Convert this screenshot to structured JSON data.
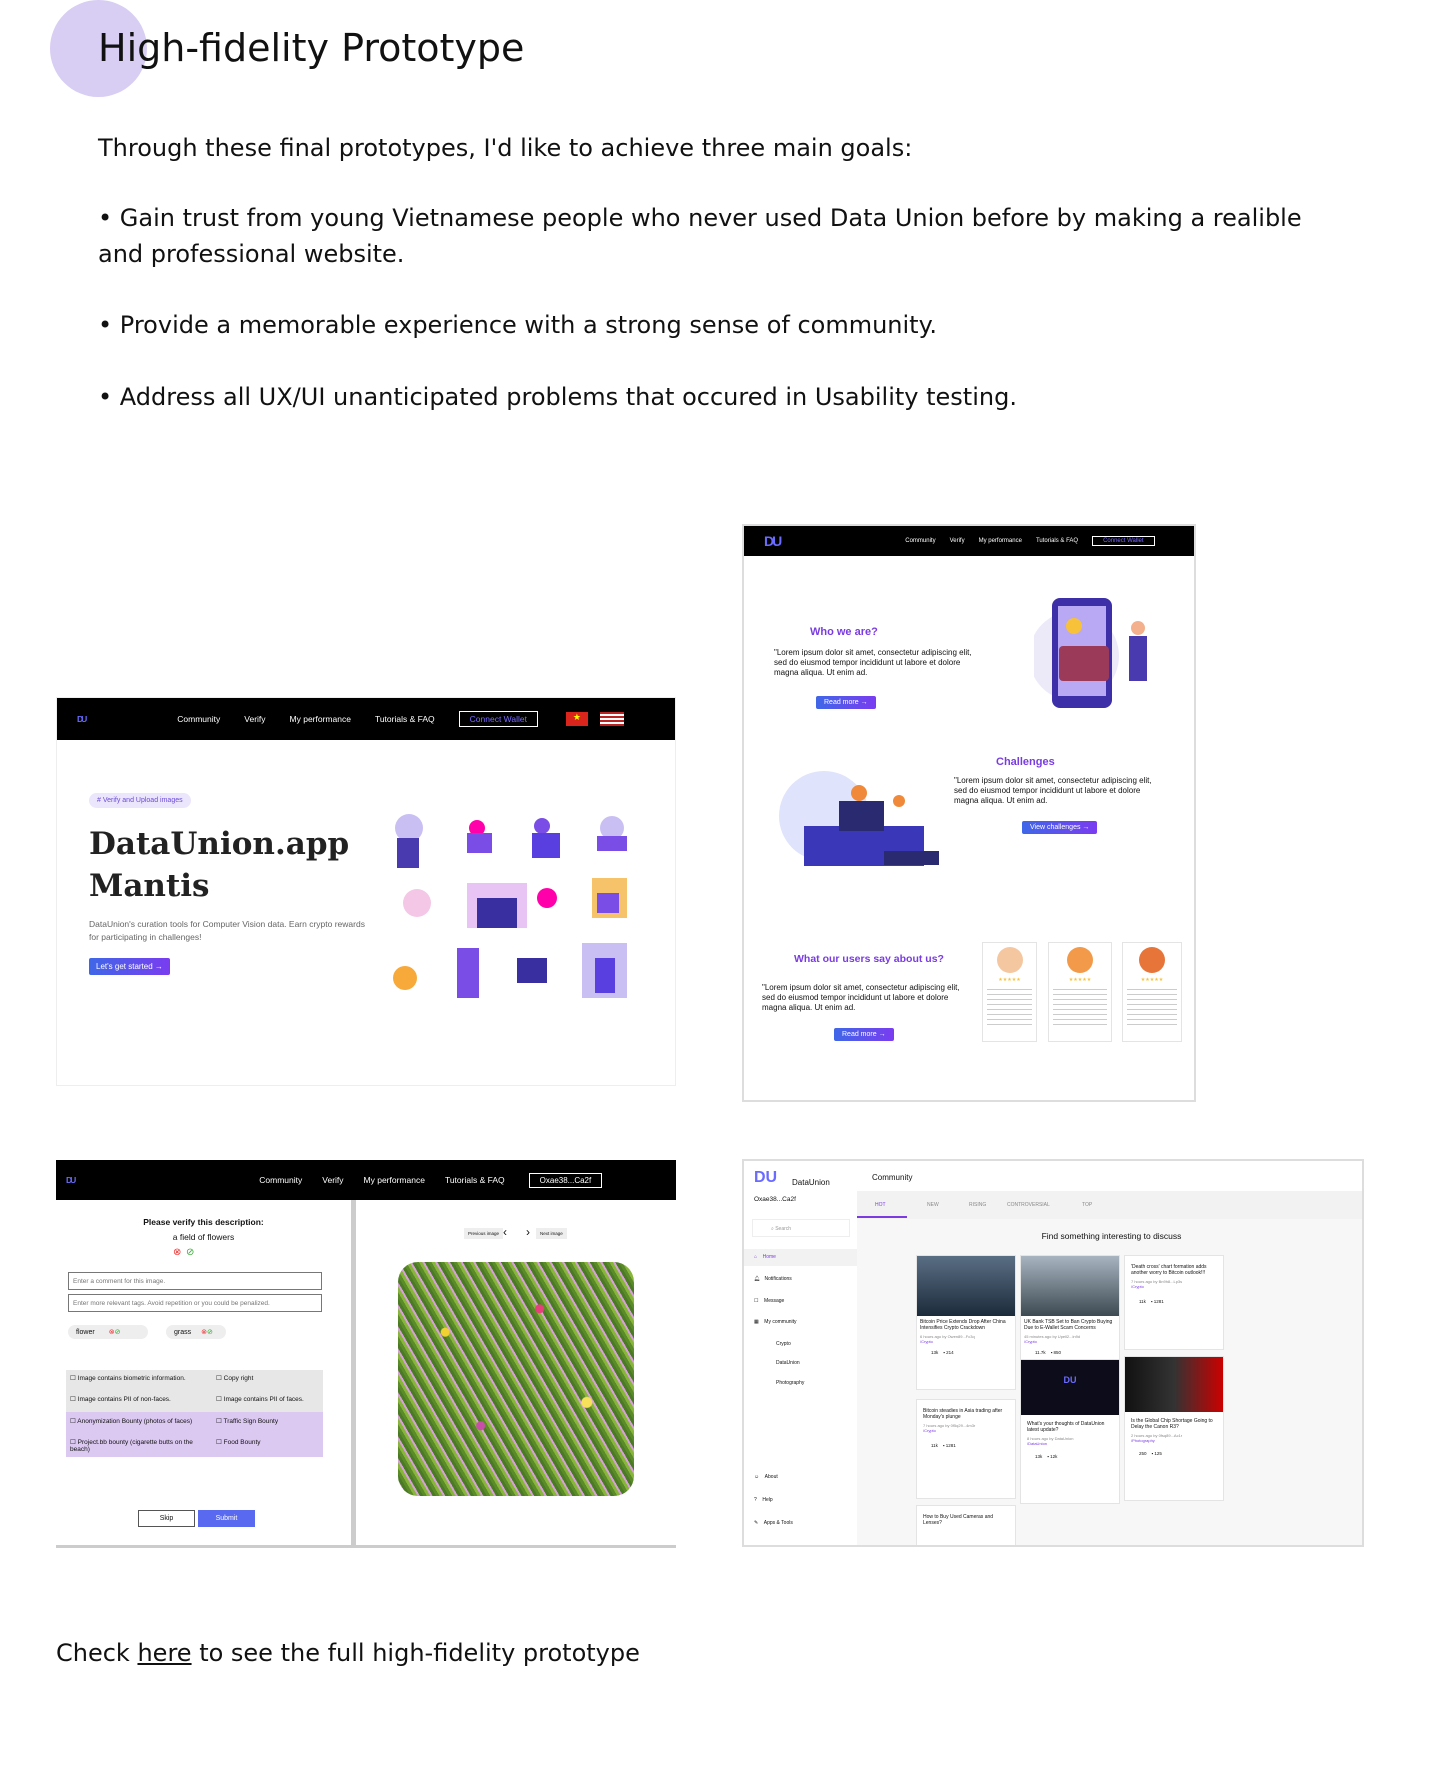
{
  "heading": "High-fidelity  Prototype",
  "intro": {
    "lead": "Through these final prototypes, I'd like to achieve three main goals:",
    "goal1": "• Gain trust from young Vietnamese people who never used Data Union before by making a realible and professional website.",
    "goal2": "• Provide a memorable experience with a strong sense of community.",
    "goal3": "• Address all UX/UI unanticipated problems that occured in Usability testing."
  },
  "landing": {
    "logo": "DU",
    "nav": [
      "Community",
      "Verify",
      "My performance",
      "Tutorials & FAQ"
    ],
    "wallet": "Connect Wallet",
    "tag": "# Verify and Upload images",
    "title1": "DataUnion.app",
    "title2": "Mantis",
    "desc": "DataUnion's curation tools for Computer Vision data. Earn crypto rewards for participating in challenges!",
    "cta": "Let's get started →"
  },
  "about": {
    "logo": "DU",
    "nav": [
      "Community",
      "Verify",
      "My performance",
      "Tutorials & FAQ"
    ],
    "wallet": "Connect Wallet",
    "who": "Who we are?",
    "lorem": "\"Lorem ipsum dolor sit amet, consectetur adipiscing elit, sed do eiusmod tempor incididunt ut labore et dolore magna aliqua. Ut enim ad.",
    "read": "Read more →",
    "challenges": "Challenges",
    "view": "View challenges →",
    "users": "What our users say about us?",
    "stars": "★★★★★"
  },
  "verify": {
    "logo": "DU",
    "nav": [
      "Community",
      "Verify",
      "My performance",
      "Tutorials & FAQ"
    ],
    "wallet": "Oxae38...Ca2f",
    "prompt": "Please verify this description:",
    "desc": "a field of flowers",
    "comment_ph": "Enter a comment for this image.",
    "tags_ph": "Enter more relevant tags. Avoid repetition or you could be penalized.",
    "tag1": "flower",
    "tag2": "grass",
    "checks": [
      "Image contains biometric information.",
      "Copy right",
      "Image contains PII of non-faces.",
      "Image contains PII of faces.",
      "Anonymization Bounty (photos of faces)",
      "Traffic Sign Bounty",
      "Project.bb bounty (cigarette butts on the beach)",
      "Food Bounty"
    ],
    "skip": "Skip",
    "submit": "Submit",
    "prev": "Previous image",
    "next": "Next image"
  },
  "community": {
    "brand": "DataUnion",
    "wallet": "Oxae38...Ca2f",
    "search": "Search",
    "menu": [
      "Home",
      "Notifications",
      "Message",
      "My community"
    ],
    "sub": [
      "Crypto",
      "DataUnion",
      "Photography"
    ],
    "bottom": [
      "About",
      "Help",
      "Apps & Tools"
    ],
    "header": "Community",
    "tabs": [
      "HOT",
      "NEW",
      "RISING",
      "CONTROVERSIAL",
      "TOP"
    ],
    "find": "Find something interesting to discuss",
    "posts": [
      {
        "title": "Bitcoin Price Extends Drop After China Intensifies Crypto Crackdown",
        "meta": "6 hours ago by Owen89...Fc3q",
        "tag": "/Crypto",
        "votes": "13k",
        "comments": "214"
      },
      {
        "title": "UK Bank TSB Set to Ban Crypto Buying Due to E-Wallet Scam Concerns",
        "meta": "45 minutes ago by Upell2...ln9d",
        "tag": "/Crypto",
        "votes": "11.7k",
        "comments": "850"
      },
      {
        "title": "'Death cross' chart formation adds another worry to Bitcoin outlook!!!",
        "meta": "7 hours ago by Bn9h8...Lp3s",
        "tag": "/Crypto",
        "votes": "11k",
        "comments": "1281"
      },
      {
        "title": "Bitcoin steadies in Asia trading after Monday's plunge",
        "meta": "7 hours ago by 0f5q29...4m3r",
        "tag": "/Crypto",
        "votes": "11k",
        "comments": "1281"
      },
      {
        "title": "What's your thoughts of DataUnion latest update?",
        "meta": "8 hours ago by DataUnion",
        "tag": "/DataUnion",
        "votes": "13k",
        "comments": "12k"
      },
      {
        "title": "Is the Global Chip Shortage Going to Delay the Canon R3?",
        "meta": "2 hours ago by 0fsq89...Ac1r",
        "tag": "/Photography",
        "votes": "250",
        "comments": "125"
      },
      {
        "title": "How to Buy Used Cameras and Lenses?",
        "meta": "",
        "tag": "",
        "votes": "",
        "comments": ""
      }
    ]
  },
  "footer": {
    "pre": "Check ",
    "link": "here",
    "post": " to see the full high-fidelity prototype"
  }
}
